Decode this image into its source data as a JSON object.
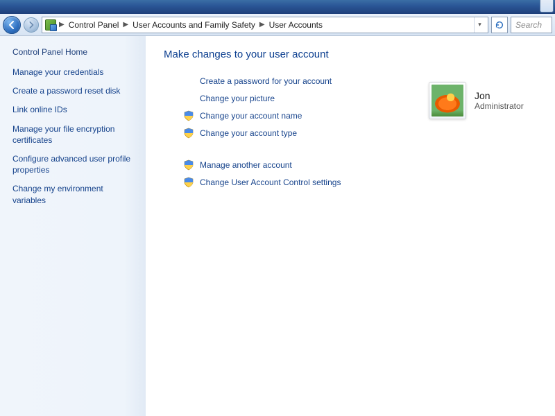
{
  "breadcrumb": {
    "items": [
      "Control Panel",
      "User Accounts and Family Safety",
      "User Accounts"
    ]
  },
  "search": {
    "placeholder": "Search"
  },
  "sidebar": {
    "home_label": "Control Panel Home",
    "links": [
      "Manage your credentials",
      "Create a password reset disk",
      "Link online IDs",
      "Manage your file encryption certificates",
      "Configure advanced user profile properties",
      "Change my environment variables"
    ]
  },
  "page_title": "Make changes to your user account",
  "tasks_primary": [
    {
      "label": "Create a password for your account",
      "shield": false
    },
    {
      "label": "Change your picture",
      "shield": false
    },
    {
      "label": "Change your account name",
      "shield": true
    },
    {
      "label": "Change your account type",
      "shield": true
    }
  ],
  "tasks_secondary": [
    {
      "label": "Manage another account",
      "shield": true
    },
    {
      "label": "Change User Account Control settings",
      "shield": true
    }
  ],
  "user": {
    "name": "Jon",
    "role": "Administrator"
  }
}
